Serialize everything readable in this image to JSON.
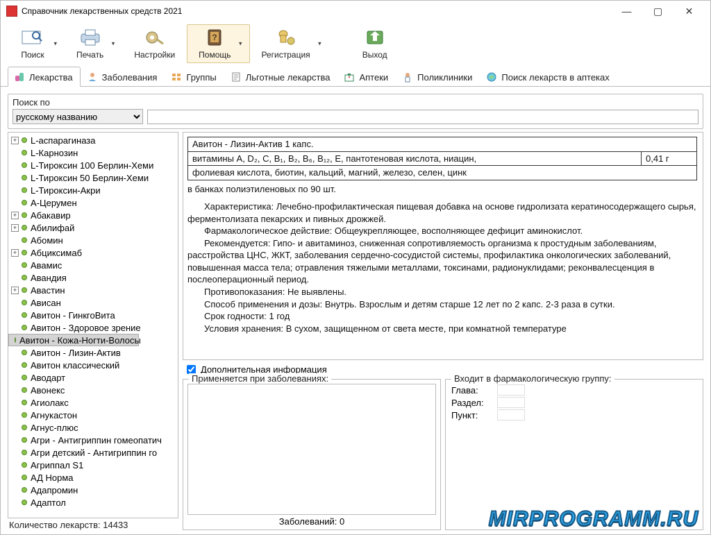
{
  "window": {
    "title": "Справочник лекарственных средств 2021"
  },
  "toolbar": [
    {
      "label": "Поиск",
      "dd": true
    },
    {
      "label": "Печать",
      "dd": true
    },
    {
      "label": "Настройки"
    },
    {
      "label": "Помощь",
      "dd": true,
      "hover": true
    },
    {
      "label": "Регистрация",
      "dd": true
    },
    {
      "label": "Выход"
    }
  ],
  "tabs": [
    {
      "label": "Лекарства",
      "active": true
    },
    {
      "label": "Заболевания"
    },
    {
      "label": "Группы"
    },
    {
      "label": "Льготные лекарства"
    },
    {
      "label": "Аптеки"
    },
    {
      "label": "Поликлиники"
    },
    {
      "label": "Поиск лекарств в аптеках"
    }
  ],
  "search": {
    "label": "Поиск по",
    "selected": "русскому названию",
    "input_value": ""
  },
  "tree": [
    {
      "exp": "+",
      "label": "L-аспарагиназа"
    },
    {
      "label": "L-Карнозин"
    },
    {
      "label": "L-Тироксин 100 Берлин-Хеми"
    },
    {
      "label": "L-Тироксин 50 Берлин-Хеми"
    },
    {
      "label": "L-Тироксин-Акри"
    },
    {
      "label": "А-Церумен"
    },
    {
      "exp": "+",
      "label": "Абакавир"
    },
    {
      "exp": "+",
      "label": "Абилифай"
    },
    {
      "label": "Абомин"
    },
    {
      "exp": "+",
      "label": "Абциксимаб"
    },
    {
      "label": "Авамис"
    },
    {
      "label": "Авандия"
    },
    {
      "exp": "+",
      "label": "Авастин"
    },
    {
      "label": "Ависан"
    },
    {
      "label": "Авитон - ГинкгоВита"
    },
    {
      "label": "Авитон - Здоровое зрение"
    },
    {
      "label": "Авитон - Кожа-Ногти-Волосы",
      "sel": true
    },
    {
      "label": "Авитон - Лизин-Актив"
    },
    {
      "label": "Авитон классический"
    },
    {
      "label": "Аводарт"
    },
    {
      "label": "Авонекс"
    },
    {
      "label": "Агиолакс"
    },
    {
      "label": "Агнукастон"
    },
    {
      "label": "Агнус-плюс"
    },
    {
      "label": "Агри - Антигриппин гомеопатич"
    },
    {
      "label": "Агри детский - Антигриппин го"
    },
    {
      "label": "Агриппал S1"
    },
    {
      "label": "АД Норма"
    },
    {
      "label": "Адапромин"
    },
    {
      "label": "Адаптол"
    }
  ],
  "count_line": "Количество лекарств: 14433",
  "detail": {
    "table": {
      "title": "Авитон - Лизин-Актив 1 капс.",
      "row2a": "витамины A, D₂, C, B₁, B₂, B₆, B₁₂, E, пантотеновая кислота, ниацин,",
      "row2b": "0,41 г",
      "row3": "фолиевая кислота, биотин, кальций, магний, железо, селен, цинк"
    },
    "pack": "в банках полиэтиленовых по 90 шт.",
    "paragraphs": [
      "Характеристика: Лечебно-профилактическая пищевая добавка на основе гидролизата кератиносодержащего сырья, ферментолизата пекарских и пивных дрожжей.",
      "Фармакологическое действие: Общеукрепляющее, восполняющее дефицит аминокислот.",
      "Рекомендуется: Гипо- и авитаминоз, сниженная сопротивляемость организма к простудным заболеваниям, расстройства ЦНС, ЖКТ, заболевания сердечно-сосудистой системы, профилактика онкологических заболеваний, повышенная масса тела; отравления тяжелыми металлами, токсинами, радионуклидами; реконвалесценция в послеоперационный период.",
      "Противопоказания: Не выявлены.",
      "Способ применения и дозы: Внутрь. Взрослым и детям старше 12 лет по 2 капс. 2-3 раза в сутки.",
      "Срок годности: 1 год",
      "Условия хранения: В сухом, защищенном от света месте, при комнатной температуре"
    ]
  },
  "addl_label": "Дополнительная информация",
  "diseases": {
    "legend": "Применяется при заболеваниях:",
    "count": "Заболеваний: 0"
  },
  "group": {
    "legend": "Входит в фармакологическую группу:",
    "rows": [
      {
        "k": "Глава:",
        "v": ""
      },
      {
        "k": "Раздел:",
        "v": ""
      },
      {
        "k": "Пункт:",
        "v": ""
      }
    ]
  },
  "watermark": "MIRPROGRAMM.RU"
}
